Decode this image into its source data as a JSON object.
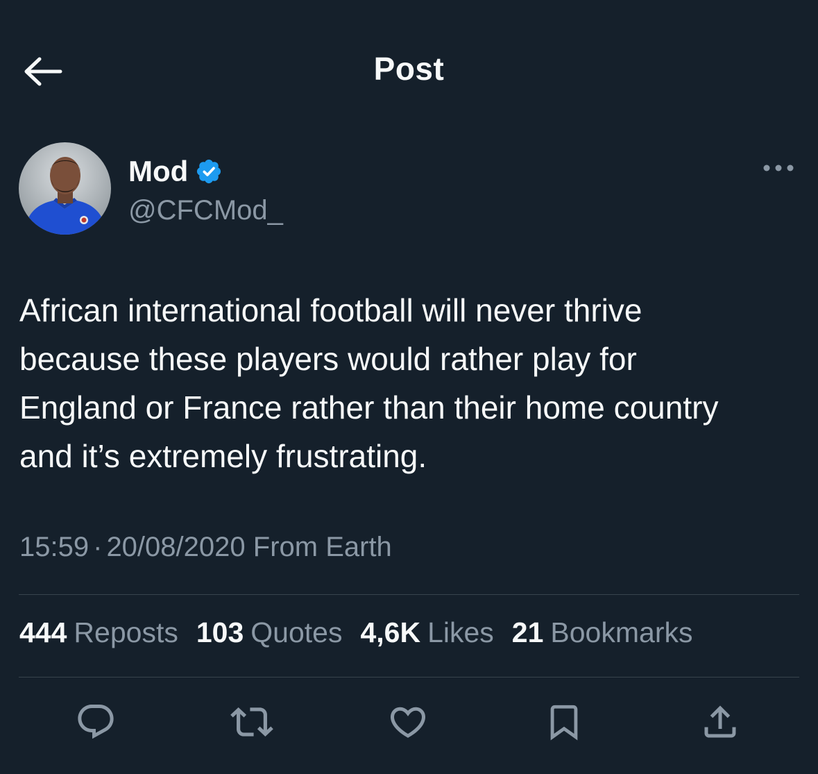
{
  "header": {
    "title": "Post",
    "back_icon": "arrow-left-icon"
  },
  "author": {
    "display_name": "Mod",
    "handle": "@CFCMod_",
    "verified": true,
    "verified_color": "#1d9bf0"
  },
  "post": {
    "text": "African international football will never thrive\nbecause these players would rather play for\nEngland or France rather than their home country\nand it’s extremely frustrating.",
    "time": "15:59",
    "separator": "·",
    "date": "20/08/2020",
    "source": "From Earth"
  },
  "stats": [
    {
      "value": "444",
      "label": "Reposts"
    },
    {
      "value": "103",
      "label": "Quotes"
    },
    {
      "value": "4,6K",
      "label": "Likes"
    },
    {
      "value": "21",
      "label": "Bookmarks"
    }
  ],
  "actions": [
    "reply-icon",
    "repost-icon",
    "like-icon",
    "bookmark-icon",
    "share-icon"
  ],
  "colors": {
    "background": "#15202b",
    "text_primary": "#f7f9f9",
    "text_secondary": "#8b98a5",
    "divider": "#38444d",
    "accent": "#1d9bf0"
  }
}
